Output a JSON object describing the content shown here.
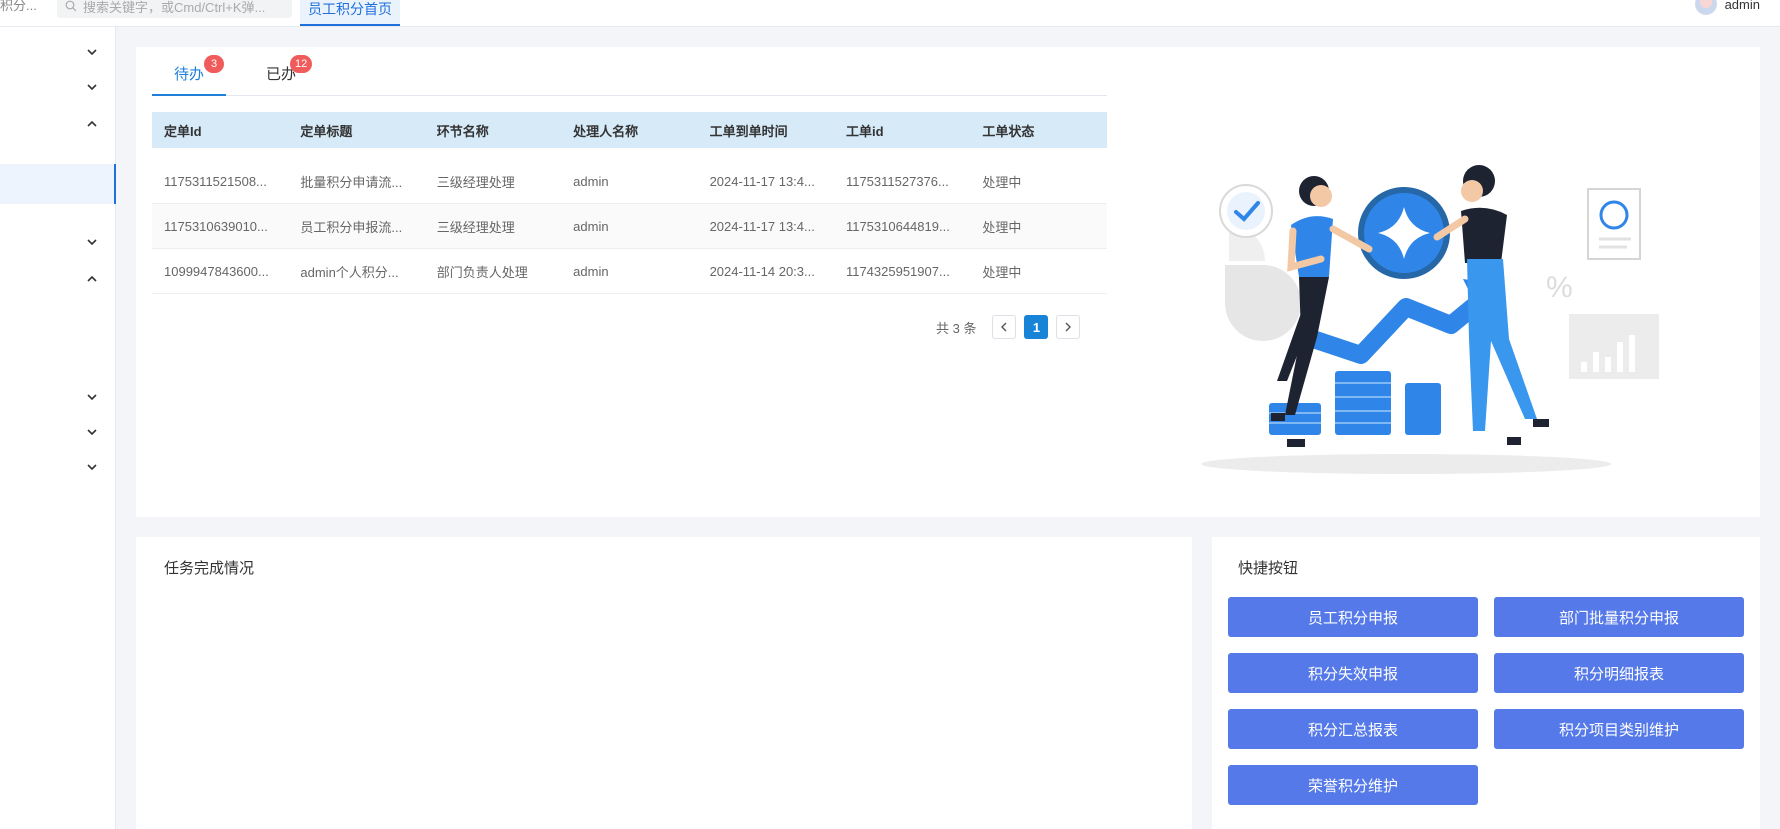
{
  "topbar": {
    "crumb": "积分...",
    "search_placeholder": "搜索关键字，或Cmd/Ctrl+K弹...",
    "active_tab": "员工积分首页",
    "username": "admin"
  },
  "tabs": [
    {
      "label": "待办",
      "badge": "3"
    },
    {
      "label": "已办",
      "badge": "12"
    }
  ],
  "table": {
    "columns": [
      "定单Id",
      "定单标题",
      "环节名称",
      "处理人名称",
      "工单到单时间",
      "工单id",
      "工单状态"
    ],
    "rows": [
      [
        "1175311521508...",
        "批量积分申请流...",
        "三级经理处理",
        "admin",
        "2024-11-17 13:4...",
        "1175311527376...",
        "处理中"
      ],
      [
        "1175310639010...",
        "员工积分申报流...",
        "三级经理处理",
        "admin",
        "2024-11-17 13:4...",
        "1175310644819...",
        "处理中"
      ],
      [
        "1099947843600...",
        "admin个人积分...",
        "部门负责人处理",
        "admin",
        "2024-11-14 20:3...",
        "1174325951907...",
        "处理中"
      ]
    ]
  },
  "pager": {
    "total": "共 3 条",
    "current": "1"
  },
  "tasks_card": {
    "title": "任务完成情况"
  },
  "quick_card": {
    "title": "快捷按钮",
    "buttons": [
      "员工积分申报",
      "部门批量积分申报",
      "积分失效申报",
      "积分明细报表",
      "积分汇总报表",
      "积分项目类别维护",
      "荣誉积分维护"
    ]
  },
  "colors": {
    "primary": "#1f7fd8",
    "quick_button": "#5579e8",
    "table_header": "#d6eaf8",
    "badge": "#f05b5b"
  }
}
